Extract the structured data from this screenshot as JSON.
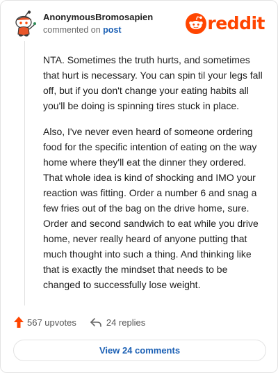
{
  "comment": {
    "author": "AnonymousBromosapien",
    "action_text": "commented on",
    "post_link_label": "post",
    "paragraphs": [
      "NTA. Sometimes the truth hurts, and sometimes that hurt is necessary. You can spin til your legs fall off, but if you don't change your eating habits all you'll be doing is spinning tires stuck in place.",
      "Also, I've never even heard of someone ordering food for the specific intention of eating on the way home where they'll eat the dinner they ordered. That whole idea is kind of shocking and IMO your reaction was fitting. Order a number 6 and snag a few fries out of the bag on the drive home, sure. Order and second sandwich to eat while you drive home, never really heard of anyone putting that much thought into such a thing. And thinking like that is exactly the mindset that needs to be changed to successfully lose weight."
    ]
  },
  "brand": {
    "wordmark": "reddit",
    "color": "#ff4500"
  },
  "footer": {
    "upvotes_label": "567 upvotes",
    "replies_label": "24 replies",
    "view_comments_label": "View 24 comments"
  },
  "colors": {
    "upvote_arrow": "#ff4500",
    "link": "#1a5fb4"
  },
  "icons": {
    "avatar": "snoo-avatar-icon",
    "upvote": "upvote-arrow-icon",
    "reply": "reply-arrow-icon",
    "logo": "reddit-snoo-icon"
  }
}
